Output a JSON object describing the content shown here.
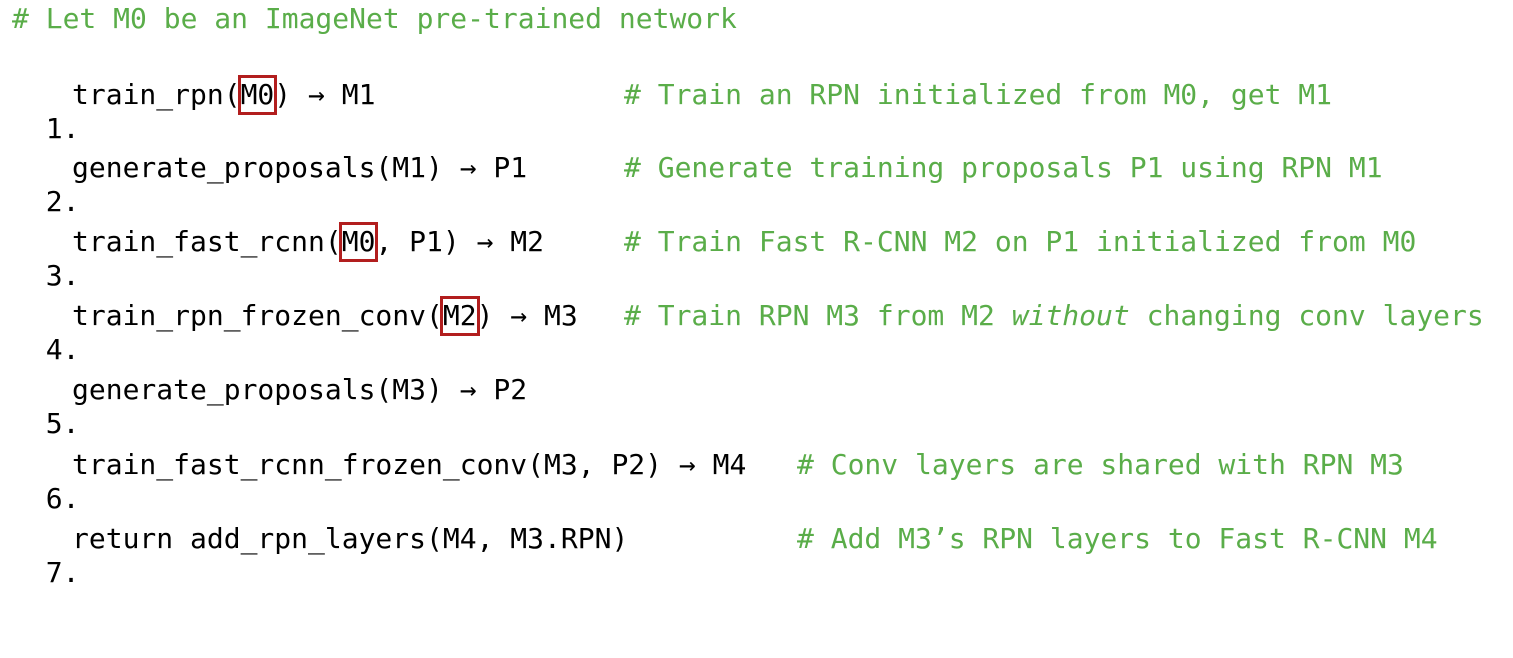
{
  "header": "# Let M0 be an ImageNet pre-trained network",
  "lines": [
    {
      "num": "1.",
      "code_pre": "train_rpn(",
      "boxed": "M0",
      "code_post": ") → M1",
      "comment": "# Train an RPN initialized from M0, get M1"
    },
    {
      "num": "2.",
      "code": "generate_proposals(M1) → P1",
      "comment": "# Generate training proposals P1 using RPN M1"
    },
    {
      "num": "3.",
      "code_pre": "train_fast_rcnn(",
      "boxed": "M0",
      "code_post": ", P1) → M2",
      "comment": "# Train Fast R-CNN M2 on P1 initialized from M0"
    },
    {
      "num": "4.",
      "code_pre": "train_rpn_frozen_conv(",
      "boxed": "M2",
      "code_post": ") → M3",
      "comment_pre": "# Train RPN M3 from M2 ",
      "comment_italic": "without",
      "comment_post": " changing conv layers"
    },
    {
      "num": "5.",
      "code": "generate_proposals(M3) → P2"
    },
    {
      "num": "6.",
      "code": "train_fast_rcnn_frozen_conv(M3, P2) → M4",
      "comment": "# Conv layers are shared with RPN M3"
    },
    {
      "num": "7.",
      "code": "return add_rpn_layers(M4, M3.RPN)",
      "comment": "# Add M3’s RPN layers to Fast R-CNN M4"
    }
  ],
  "colors": {
    "comment": "#5aad49",
    "highlight_box": "#b21e1e"
  }
}
